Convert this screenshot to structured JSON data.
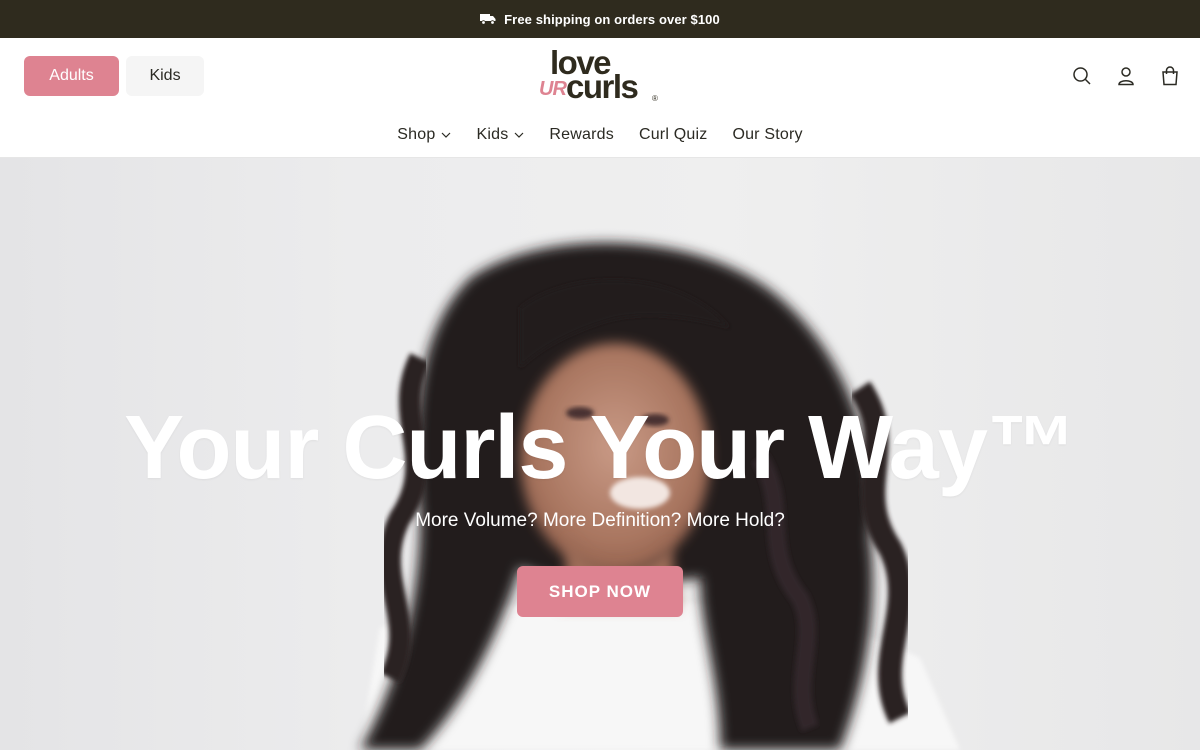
{
  "announcement": {
    "text": "Free shipping on orders over $100",
    "icon": "truck-icon"
  },
  "header": {
    "segments": [
      {
        "label": "Adults",
        "active": true
      },
      {
        "label": "Kids",
        "active": false
      }
    ],
    "logo": {
      "line1": "love",
      "accent": "UR",
      "line2": "curls",
      "mark": "®"
    },
    "icons": [
      "search-icon",
      "account-icon",
      "cart-icon"
    ]
  },
  "nav": {
    "items": [
      {
        "label": "Shop",
        "has_dropdown": true
      },
      {
        "label": "Kids",
        "has_dropdown": true
      },
      {
        "label": "Rewards",
        "has_dropdown": false
      },
      {
        "label": "Curl Quiz",
        "has_dropdown": false
      },
      {
        "label": "Our Story",
        "has_dropdown": false
      }
    ]
  },
  "hero": {
    "headline": "Your Curls Your Way™",
    "subheadline": "More Volume? More Definition? More Hold?",
    "cta_label": "SHOP NOW"
  },
  "colors": {
    "announcement_bg": "#2f2b1e",
    "brand_pink": "#de8391",
    "text_dark": "#2b2a23"
  }
}
